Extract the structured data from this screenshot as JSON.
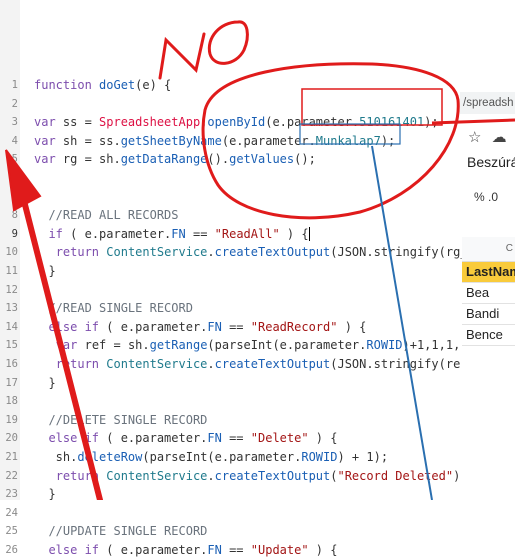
{
  "editor": {
    "line_numbers": [
      "1",
      "2",
      "3",
      "4",
      "5",
      "6",
      "7",
      "8",
      "9",
      "10",
      "11",
      "12",
      "13",
      "14",
      "15",
      "16",
      "17",
      "18",
      "19",
      "20",
      "21",
      "22",
      "23",
      "24",
      "25",
      "26"
    ],
    "lines": [
      [
        [
          "kw",
          "function "
        ],
        [
          "fn",
          "doGet"
        ],
        [
          "t",
          "(e) {"
        ]
      ],
      [],
      [
        [
          "kw",
          "var "
        ],
        [
          "t",
          "ss = "
        ],
        [
          "cls",
          "SpreadsheetApp"
        ],
        [
          "t",
          "."
        ],
        [
          "fn",
          "openById"
        ],
        [
          "t",
          "(e.parameter."
        ],
        [
          "obj",
          "510161401"
        ],
        [
          "t",
          ");"
        ]
      ],
      [
        [
          "kw",
          "var "
        ],
        [
          "t",
          "sh = ss."
        ],
        [
          "fn",
          "getSheetByName"
        ],
        [
          "t",
          "(e.parameter."
        ],
        [
          "obj",
          "Munkalap7"
        ],
        [
          "t",
          ");"
        ]
      ],
      [
        [
          "kw",
          "var "
        ],
        [
          "t",
          "rg = sh."
        ],
        [
          "fn",
          "getDataRange"
        ],
        [
          "t",
          "()."
        ],
        [
          "fn",
          "getValues"
        ],
        [
          "t",
          "();"
        ]
      ],
      [],
      [],
      [
        [
          "com",
          "  //READ ALL RECORDS"
        ]
      ],
      [
        [
          "t",
          "  "
        ],
        [
          "kw",
          "if "
        ],
        [
          "t",
          "( e.parameter."
        ],
        [
          "prop",
          "FN"
        ],
        [
          "t",
          " == "
        ],
        [
          "str",
          "\"ReadAll\""
        ],
        [
          "t",
          " ) {"
        ],
        [
          "cur",
          ""
        ]
      ],
      [
        [
          "t",
          "   "
        ],
        [
          "kw",
          "return "
        ],
        [
          "obj",
          "ContentService"
        ],
        [
          "t",
          "."
        ],
        [
          "fn",
          "createTextOutput"
        ],
        [
          "t",
          "(JSON.stringify(rg_"
        ]
      ],
      [
        [
          "t",
          "  }"
        ]
      ],
      [],
      [
        [
          "com",
          "  //READ SINGLE RECORD"
        ]
      ],
      [
        [
          "t",
          "  "
        ],
        [
          "kw",
          "else if "
        ],
        [
          "t",
          "( e.parameter."
        ],
        [
          "prop",
          "FN"
        ],
        [
          "t",
          " == "
        ],
        [
          "str",
          "\"ReadRecord\""
        ],
        [
          "t",
          " ) {"
        ]
      ],
      [
        [
          "t",
          "   "
        ],
        [
          "kw",
          "var "
        ],
        [
          "t",
          "ref = sh."
        ],
        [
          "fn",
          "getRange"
        ],
        [
          "t",
          "(parseInt(e.parameter."
        ],
        [
          "prop",
          "ROWID"
        ],
        [
          "t",
          ")+1,1,1,"
        ]
      ],
      [
        [
          "t",
          "   "
        ],
        [
          "kw",
          "return "
        ],
        [
          "obj",
          "ContentService"
        ],
        [
          "t",
          "."
        ],
        [
          "fn",
          "createTextOutput"
        ],
        [
          "t",
          "(JSON.stringify(re"
        ]
      ],
      [
        [
          "t",
          "  }"
        ]
      ],
      [],
      [
        [
          "com",
          "  //DELETE SINGLE RECORD"
        ]
      ],
      [
        [
          "t",
          "  "
        ],
        [
          "kw",
          "else if "
        ],
        [
          "t",
          "( e.parameter."
        ],
        [
          "prop",
          "FN"
        ],
        [
          "t",
          " == "
        ],
        [
          "str",
          "\"Delete\""
        ],
        [
          "t",
          " ) {"
        ]
      ],
      [
        [
          "t",
          "   sh."
        ],
        [
          "fn",
          "deleteRow"
        ],
        [
          "t",
          "(parseInt(e.parameter."
        ],
        [
          "prop",
          "ROWID"
        ],
        [
          "t",
          ") + 1);"
        ]
      ],
      [
        [
          "t",
          "   "
        ],
        [
          "kw",
          "return "
        ],
        [
          "obj",
          "ContentService"
        ],
        [
          "t",
          "."
        ],
        [
          "fn",
          "createTextOutput"
        ],
        [
          "t",
          "("
        ],
        [
          "str",
          "\"Record Deleted\""
        ],
        [
          "t",
          ")"
        ]
      ],
      [
        [
          "t",
          "  }"
        ]
      ],
      [],
      [
        [
          "com",
          "  //UPDATE SINGLE RECORD"
        ]
      ],
      [
        [
          "t",
          "  "
        ],
        [
          "kw",
          "else if "
        ],
        [
          "t",
          "( e.parameter."
        ],
        [
          "prop",
          "FN"
        ],
        [
          "t",
          " == "
        ],
        [
          "str",
          "\"Update\""
        ],
        [
          "t",
          " ) {"
        ]
      ]
    ]
  },
  "sheets_panel": {
    "url_fragment": "/spreadsh",
    "menu_label": "Beszúrá",
    "format_buttons": "%   .0",
    "column_letter": "C",
    "rows": [
      "LastNam",
      "Bea",
      "Bandi",
      "Bence"
    ]
  },
  "annotation": {
    "handwritten_text": "NO",
    "ink_color": "#e01b1b",
    "box_color": "#2a6fb0"
  }
}
